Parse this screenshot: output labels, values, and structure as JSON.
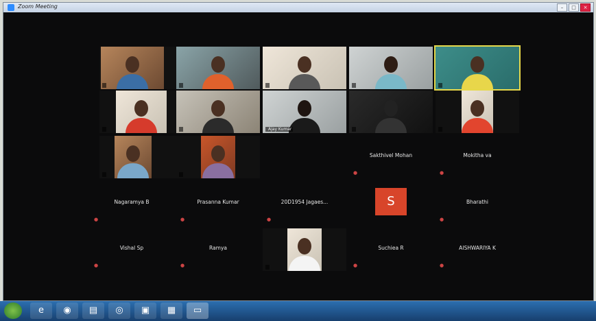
{
  "window": {
    "title": "Zoom Meeting",
    "buttons": [
      "–",
      "□",
      "×"
    ]
  },
  "video_tiles": [
    {
      "id": "t1",
      "label": ""
    },
    {
      "id": "t2",
      "label": ""
    },
    {
      "id": "t3",
      "label": ""
    },
    {
      "id": "t4",
      "label": ""
    },
    {
      "id": "t5",
      "label": ""
    },
    {
      "id": "t6",
      "label": ""
    },
    {
      "id": "t7",
      "label": ""
    },
    {
      "id": "t8",
      "label": "Ajay Kumar"
    },
    {
      "id": "t9",
      "label": ""
    },
    {
      "id": "t10",
      "label": ""
    },
    {
      "id": "t11",
      "label": ""
    },
    {
      "id": "t12",
      "label": ""
    },
    {
      "id": "t13",
      "label": ""
    }
  ],
  "name_tiles": [
    {
      "id": "n1",
      "name": "Sakthivel Mohan"
    },
    {
      "id": "n2",
      "name": "Mokitha va"
    },
    {
      "id": "n3",
      "name": "Nagaramya B"
    },
    {
      "id": "n4",
      "name": "Prasanna Kumar"
    },
    {
      "id": "n5",
      "name": "20D1954 Jagaes..."
    },
    {
      "id": "n6",
      "name": "Bharathi"
    },
    {
      "id": "n7",
      "name": "Vishal Sp"
    },
    {
      "id": "n8",
      "name": "Ramya"
    },
    {
      "id": "n9",
      "name": "Suchiea R"
    },
    {
      "id": "n10",
      "name": "AISHWARIYA K"
    }
  ],
  "avatar_tile": {
    "initial": "S",
    "label": ""
  },
  "icons": {
    "start": "windows-start-icon",
    "ie": "internet-explorer-icon",
    "chrome": "chrome-icon",
    "folder": "folder-icon",
    "firefox": "firefox-icon",
    "network": "network-icon",
    "word": "document-icon",
    "zoom": "zoom-icon"
  },
  "colors": {
    "zoom_accent": "#2d8cff",
    "active_speaker": "#e6d84a",
    "avatar_bg": "#d8452a"
  }
}
